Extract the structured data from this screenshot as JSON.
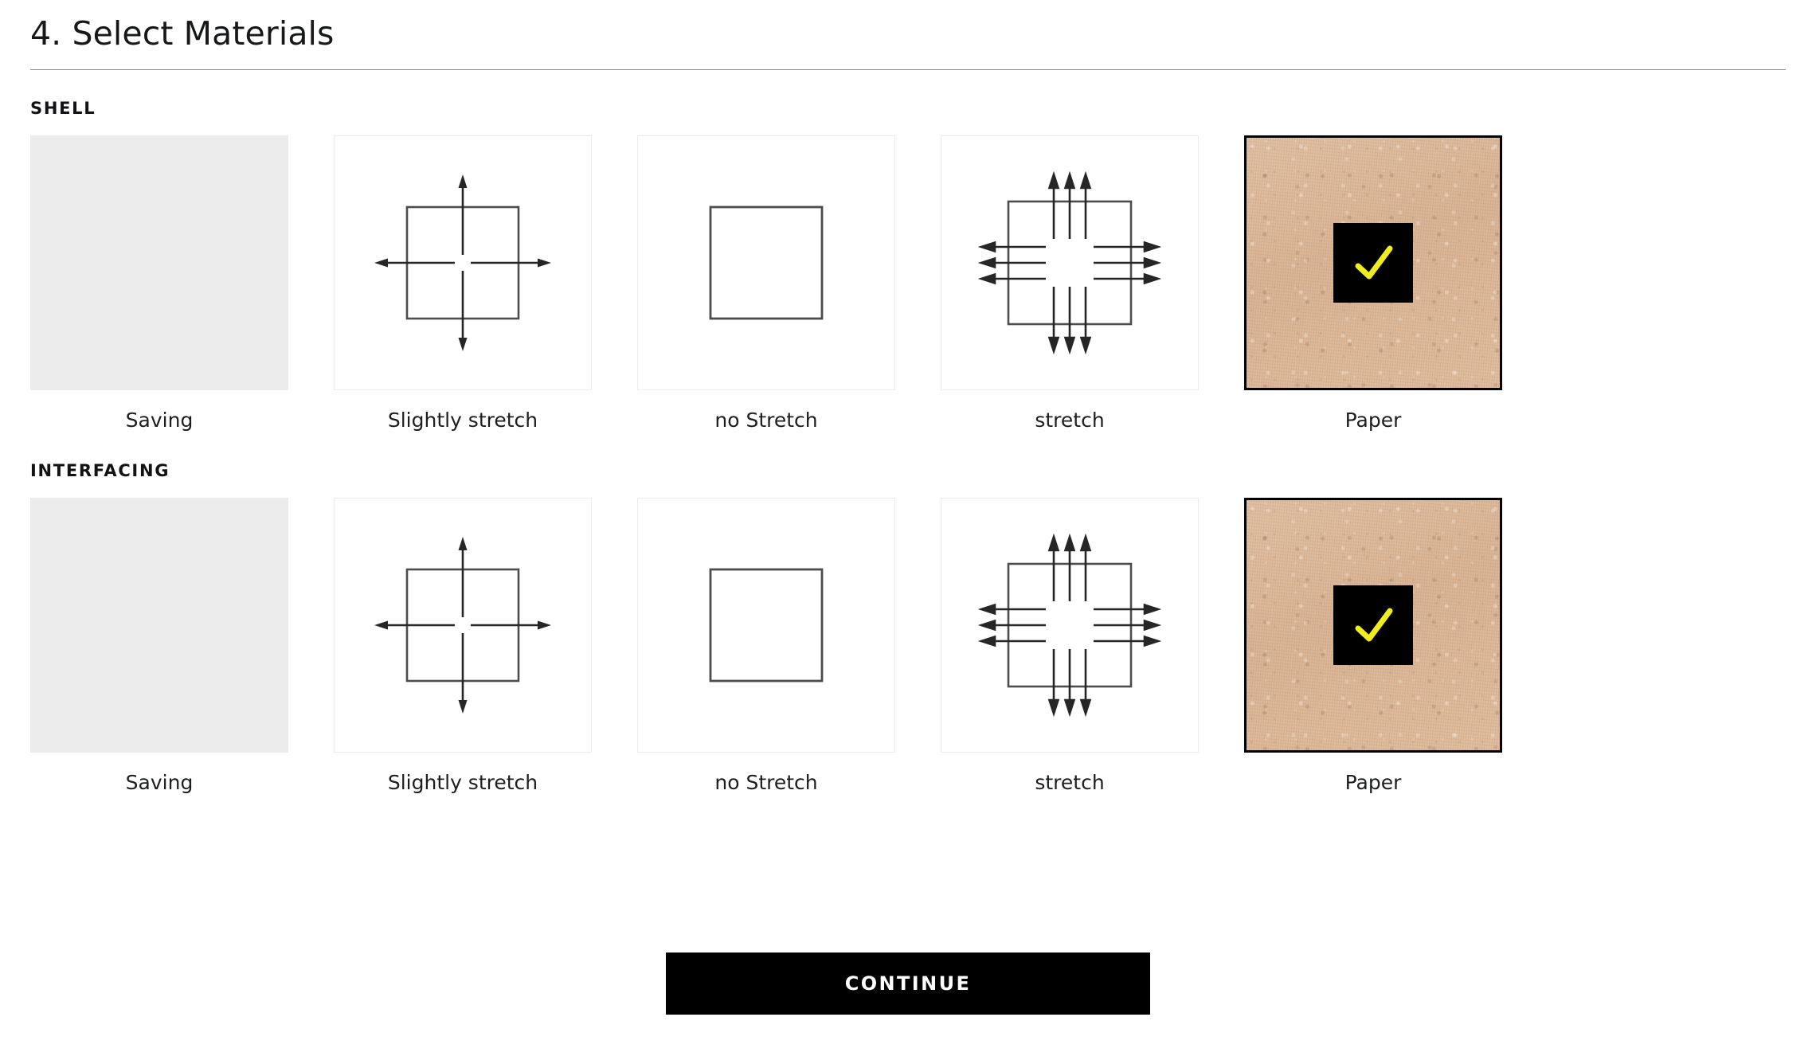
{
  "header": {
    "title": "4. Select Materials"
  },
  "colors": {
    "accent_check": "#F0EC1E",
    "badge_background": "#000000",
    "paper_swatch": "#D9B495",
    "placeholder_tile": "#ECECEC",
    "tile_border": "#ECECEC",
    "selected_border": "#000000",
    "rule": "#8C8C8C",
    "text": "#1A1A1A",
    "continue_background": "#000000",
    "continue_text": "#FFFFFF"
  },
  "sections": [
    {
      "label": "SHELL",
      "name": "shell",
      "tiles": [
        {
          "caption": "Saving",
          "kind": "placeholder",
          "icon": "empty-placeholder",
          "selected": false
        },
        {
          "caption": "Slightly stretch",
          "kind": "diagram",
          "icon": "slightly-stretch-icon",
          "selected": false
        },
        {
          "caption": "no Stretch",
          "kind": "diagram",
          "icon": "no-stretch-icon",
          "selected": false
        },
        {
          "caption": "stretch",
          "kind": "diagram",
          "icon": "stretch-icon",
          "selected": false
        },
        {
          "caption": "Paper",
          "kind": "paper",
          "icon": "check-icon",
          "selected": true
        }
      ]
    },
    {
      "label": "INTERFACING",
      "name": "interfacing",
      "tiles": [
        {
          "caption": "Saving",
          "kind": "placeholder",
          "icon": "empty-placeholder",
          "selected": false
        },
        {
          "caption": "Slightly stretch",
          "kind": "diagram",
          "icon": "slightly-stretch-icon",
          "selected": false
        },
        {
          "caption": "no Stretch",
          "kind": "diagram",
          "icon": "no-stretch-icon",
          "selected": false
        },
        {
          "caption": "stretch",
          "kind": "diagram",
          "icon": "stretch-icon",
          "selected": false
        },
        {
          "caption": "Paper",
          "kind": "paper",
          "icon": "check-icon",
          "selected": true
        }
      ]
    }
  ],
  "footer": {
    "continue_label": "CONTINUE"
  }
}
